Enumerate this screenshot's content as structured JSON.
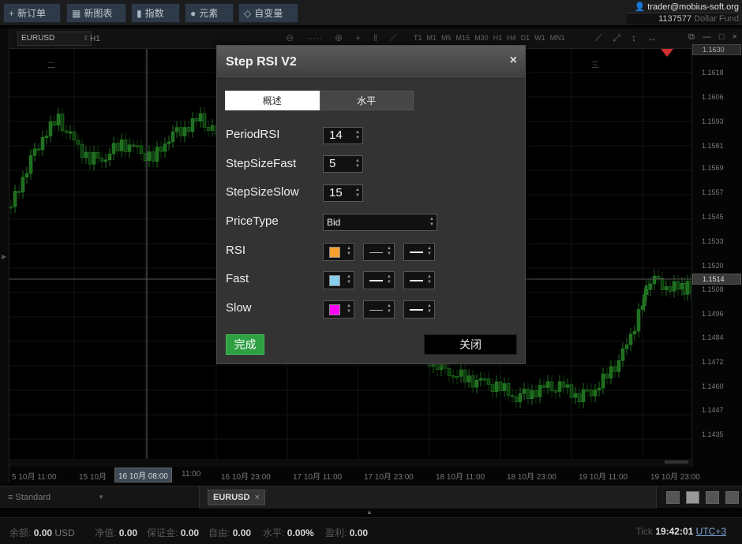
{
  "toolbar": {
    "new_order": "新订单",
    "new_chart": "新图表",
    "indicators": "指数",
    "elements": "元素",
    "custom": "自变量"
  },
  "account": {
    "user": "trader@mobius-soft.org",
    "id": "1137577",
    "fund": "Dollar Fund"
  },
  "chart_toolbar": {
    "symbol": "EURUSD",
    "timeframe": "H1",
    "timeframes": [
      "T1",
      "M1",
      "M5",
      "M15",
      "M30",
      "H1",
      "H4",
      "D1",
      "W1",
      "MN1"
    ]
  },
  "price_axis": {
    "top_label": "1.1630",
    "labels": [
      "1.1618",
      "1.1606",
      "1.1593",
      "1.1581",
      "1.1569",
      "1.1557",
      "1.1545",
      "1.1533",
      "1.1520",
      "1.1508",
      "1.1496",
      "1.1484",
      "1.1472",
      "1.1460",
      "1.1447",
      "1.1435"
    ],
    "current": "1.1514"
  },
  "time_axis": {
    "labels": [
      "5 10月 11:00",
      "15 10月",
      "11:00",
      "16 10月 23:00",
      "17 10月 11:00",
      "17 10月 23:00",
      "18 10月 11:00",
      "18 10月 23:00",
      "19 10月 11:00",
      "19 10月 23:00"
    ],
    "crosshair": "16 10月 08:00"
  },
  "chart_marks": {
    "left": "二",
    "right": "三"
  },
  "dialog": {
    "title": "Step RSI V2",
    "close_glyph": "×",
    "tabs": [
      "概述",
      "水平"
    ],
    "params": {
      "period_rsi_label": "PeriodRSI",
      "period_rsi_value": "14",
      "step_fast_label": "StepSizeFast",
      "step_fast_value": "5",
      "step_slow_label": "StepSizeSlow",
      "step_slow_value": "15",
      "price_type_label": "PriceType",
      "price_type_value": "Bid"
    },
    "lines": [
      {
        "label": "RSI",
        "color": "#f5a030"
      },
      {
        "label": "Fast",
        "color": "#87ceeb"
      },
      {
        "label": "Slow",
        "color": "#ff00ff"
      }
    ],
    "done": "完成",
    "close": "关闭"
  },
  "bottom": {
    "layout": "Standard",
    "symbol_tab": "EURUSD",
    "tab_close": "×"
  },
  "status": {
    "balance_label": "余额:",
    "balance": "0.00",
    "currency": "USD",
    "equity_label": "净值:",
    "equity": "0.00",
    "margin_label": "保证金:",
    "margin": "0.00",
    "free_label": "自由:",
    "free": "0.00",
    "level_label": "水平:",
    "level": "0.00%",
    "profit_label": "盈利:",
    "profit": "0.00",
    "tick_label": "Tick",
    "time": "19:42:01",
    "tz": "UTC+3"
  },
  "colors": {
    "candle_up": "#1f6e1f",
    "candle_down": "#0d3d0d",
    "accent_green": "#2ea043"
  }
}
